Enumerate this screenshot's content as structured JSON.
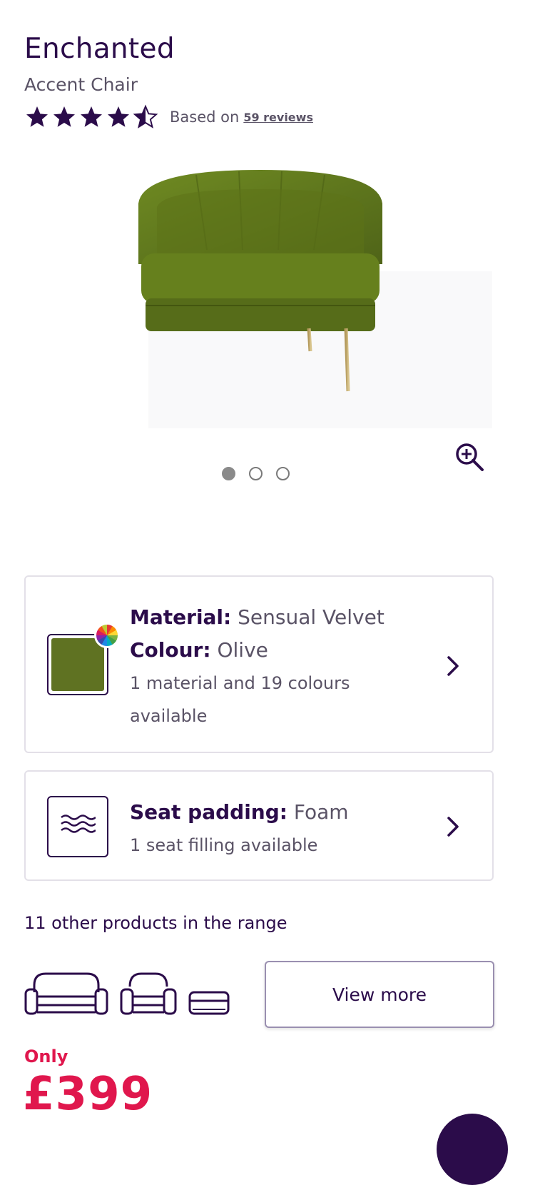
{
  "product": {
    "title": "Enchanted",
    "subtitle": "Accent Chair",
    "rating": 4.5,
    "rating_max": 5,
    "reviews_prefix": "Based on",
    "reviews_link": "59 reviews"
  },
  "gallery": {
    "image_icon": "olive-velvet-accent-chair-image",
    "active_slide": 1,
    "slides": 3,
    "zoom_icon": "zoom-in-icon"
  },
  "material_card": {
    "material_label": "Material:",
    "material_value": "Sensual Velvet",
    "colour_label": "Colour:",
    "colour_value": "Olive",
    "availability": "1 material and 19 colours available",
    "swatch_color": "#5f7222"
  },
  "padding_card": {
    "label": "Seat padding:",
    "value": "Foam",
    "availability": "1 seat filling available"
  },
  "range": {
    "title": "11 other products in the range",
    "icons": [
      "sofa-icon",
      "armchair-icon",
      "footstool-icon"
    ],
    "button_label": "View more"
  },
  "pricing": {
    "only_label": "Only",
    "price": "£399"
  },
  "colors": {
    "brand_purple": "#2b0c4a",
    "price_red": "#e0174d"
  }
}
